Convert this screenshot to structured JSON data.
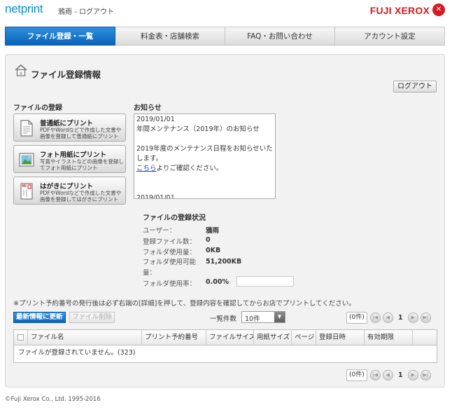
{
  "header": {
    "logo": "netprint",
    "user_line": "鴉雨 - ログアウト",
    "brand": "FUJI XEROX"
  },
  "nav": {
    "tabs": [
      {
        "label": "ファイル登録・一覧",
        "active": true
      },
      {
        "label": "料金表・店舗検索",
        "active": false
      },
      {
        "label": "FAQ・お問い合わせ",
        "active": false
      },
      {
        "label": "アカウント設定",
        "active": false
      }
    ]
  },
  "page": {
    "title": "ファイル登録情報",
    "logout_button": "ログアウト"
  },
  "register": {
    "heading": "ファイルの登録",
    "buttons": [
      {
        "title": "普通紙にプリント",
        "desc": "PDFやWordなどで作成した文書や画像を登録して普通紙にプリント"
      },
      {
        "title": "フォト用紙にプリント",
        "desc": "写真やイラストなどの画像を登録してフォト用紙にプリント"
      },
      {
        "title": "はがきにプリント",
        "desc": "PDFやWordなどで作成した文書や画像を登録してはがきにプリント"
      }
    ]
  },
  "notices": {
    "heading": "お知らせ",
    "date": "2019/01/01",
    "subject": "年間メンテナンス（2019年）のお知らせ",
    "body": "2019年度のメンテナンス日程をお知らせいたします。",
    "link_text": "こちら",
    "link_suffix": "よりご確認ください。",
    "next_date": "2019/01/01"
  },
  "status": {
    "heading": "ファイルの登録状況",
    "rows": [
      {
        "label": "ユーザー：",
        "value": "鴉雨"
      },
      {
        "label": "登録ファイル数：",
        "value": "0"
      },
      {
        "label": "フォルダ使用量：",
        "value": "0KB"
      },
      {
        "label": "フォルダ使用可能量：",
        "value": "51,200KB"
      },
      {
        "label": "フォルダ使用率：",
        "value": "0.00%"
      }
    ],
    "usage_fraction": 0.0
  },
  "list": {
    "note": "※プリント予約番号の発行後は必ず右端の[詳細]を押して、登録内容を確認してからお店でプリントしてください。",
    "refresh_button": "最新情報に更新",
    "delete_button": "ファイル削除",
    "perpage_label": "一覧件数",
    "perpage_value": "10件",
    "count": "(0件)",
    "page_number": "1",
    "columns": [
      "ファイル名",
      "プリント予約番号",
      "ファイルサイズ",
      "用紙サイズ",
      "ページ",
      "登録日時",
      "有効期限",
      ""
    ],
    "empty_message": "ファイルが登録されていません。(323)"
  },
  "footer": {
    "copyright": "©Fuji Xerox Co., Ltd. 1995-2016"
  },
  "colors": {
    "accent_blue": "#0a63ba",
    "brand_red": "#d71920",
    "logo_blue": "#0a8fcb"
  }
}
